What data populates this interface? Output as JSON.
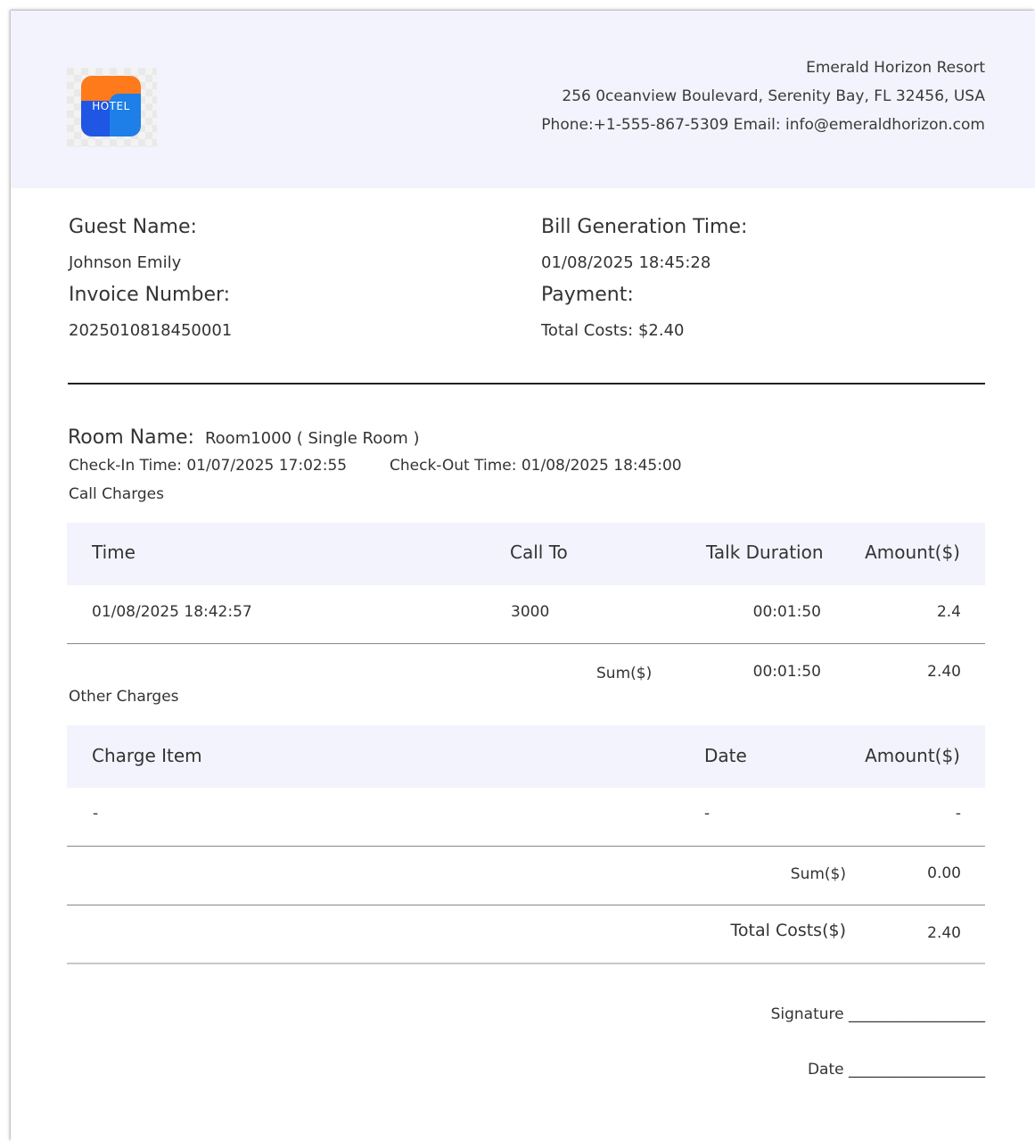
{
  "header": {
    "logo_text": "HOTEL",
    "company_name": "Emerald Horizon Resort",
    "address": "256 0ceanview Boulevard, Serenity Bay, FL 32456, USA",
    "contact": "Phone:+1-555-867-5309 Email: info@emeraldhorizon.com"
  },
  "info": {
    "guest_name_label": "Guest Name:",
    "guest_name": "Johnson Emily",
    "invoice_number_label": "Invoice Number:",
    "invoice_number": "2025010818450001",
    "bill_time_label": "Bill Generation Time:",
    "bill_time": "01/08/2025 18:45:28",
    "payment_label": "Payment:",
    "payment": "Total Costs: $2.40"
  },
  "room": {
    "name_label": "Room Name:",
    "name_value": "Room1000 ( Single Room )",
    "check_in": "Check-In Time: 01/07/2025 17:02:55",
    "check_out": "Check-Out Time: 01/08/2025 18:45:00"
  },
  "call_charges": {
    "title": "Call Charges",
    "headers": [
      "Time",
      "Call To",
      "Talk Duration",
      "Amount($)"
    ],
    "rows": [
      [
        "01/08/2025 18:42:57",
        "3000",
        "00:01:50",
        "2.4"
      ]
    ],
    "sum_label": "Sum($)",
    "sum_duration": "00:01:50",
    "sum_amount": "2.40"
  },
  "other_charges": {
    "title": "Other Charges",
    "headers": [
      "Charge Item",
      "Date",
      "Amount($)"
    ],
    "rows": [
      [
        "-",
        "-",
        "-"
      ]
    ],
    "sum_label": "Sum($)",
    "sum_amount": "0.00",
    "total_label": "Total Costs($)",
    "total_amount": "2.40"
  },
  "footer": {
    "signature": "Signature __________________",
    "date": "Date __________________"
  },
  "colors": {
    "header_bg": "#f2f3fc",
    "logo_orange": "#ff7a1a",
    "logo_blue": "#1f56e3"
  }
}
